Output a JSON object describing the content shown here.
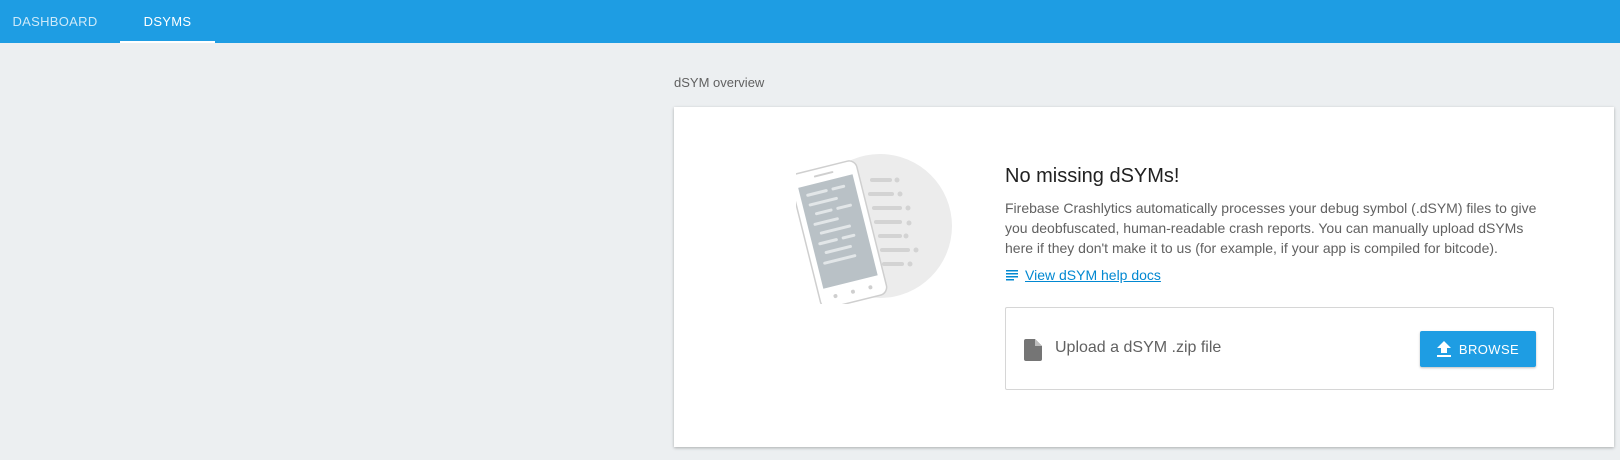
{
  "tabs": {
    "dashboard": "DASHBOARD",
    "dsyms": "DSYMS",
    "active": "DSYMS"
  },
  "section": {
    "title": "dSYM overview"
  },
  "card": {
    "heading": "No missing dSYMs!",
    "description": "Firebase Crashlytics automatically processes your debug symbol (.dSYM) files to give you deobfuscated, human-readable crash reports. You can manually upload dSYMs here if they don't make it to us (for example, if your app is compiled for bitcode).",
    "help_link": "View dSYM help docs",
    "help_link_icon": "notes-icon",
    "illustration": "phone-illustration"
  },
  "upload": {
    "label": "Upload a dSYM .zip file",
    "file_icon": "file-icon",
    "browse_label": "BROWSE",
    "browse_icon": "upload-icon"
  },
  "colors": {
    "brand": "#1e9de3",
    "link": "#0288d1",
    "background": "#eceff1"
  }
}
